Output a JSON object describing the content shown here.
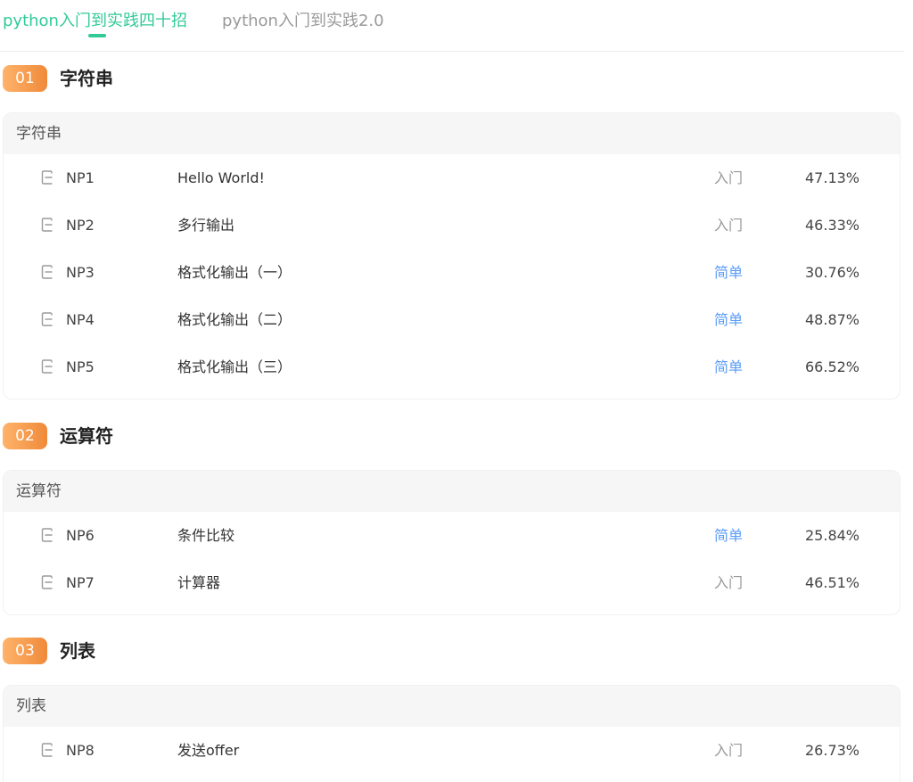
{
  "tabs": [
    {
      "label": "python入门到实践四十招",
      "active": true
    },
    {
      "label": "python入门到实践2.0",
      "active": false
    }
  ],
  "colors": {
    "accent": "#32ca99",
    "section_badge_start": "#ffb36b",
    "section_badge_end": "#ef8a3a",
    "level_intro": "#999999",
    "level_easy": "#5a9cf8"
  },
  "sections": [
    {
      "num": "01",
      "title": "字符串",
      "card_title": "字符串",
      "problems": [
        {
          "id": "NP1",
          "title": "Hello World!",
          "level": "入门",
          "rate": "47.13%"
        },
        {
          "id": "NP2",
          "title": "多行输出",
          "level": "入门",
          "rate": "46.33%"
        },
        {
          "id": "NP3",
          "title": "格式化输出（一）",
          "level": "简单",
          "rate": "30.76%"
        },
        {
          "id": "NP4",
          "title": "格式化输出（二）",
          "level": "简单",
          "rate": "48.87%"
        },
        {
          "id": "NP5",
          "title": "格式化输出（三）",
          "level": "简单",
          "rate": "66.52%"
        }
      ]
    },
    {
      "num": "02",
      "title": "运算符",
      "card_title": "运算符",
      "problems": [
        {
          "id": "NP6",
          "title": "条件比较",
          "level": "简单",
          "rate": "25.84%"
        },
        {
          "id": "NP7",
          "title": "计算器",
          "level": "入门",
          "rate": "46.51%"
        }
      ]
    },
    {
      "num": "03",
      "title": "列表",
      "card_title": "列表",
      "problems": [
        {
          "id": "NP8",
          "title": "发送offer",
          "level": "入门",
          "rate": "26.73%"
        }
      ]
    }
  ],
  "icons": {
    "problem_icon": "document-icon"
  }
}
